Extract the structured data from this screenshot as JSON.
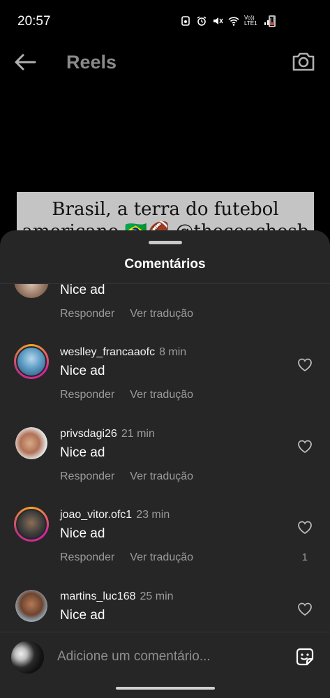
{
  "status_bar": {
    "time": "20:57",
    "network_label": "Vo)) LTE1",
    "icons": [
      "notification-icon",
      "alarm-icon",
      "mute-icon",
      "wifi-icon",
      "signal-icon",
      "battery-icon"
    ]
  },
  "header": {
    "title": "Reels",
    "back_icon": "arrow-left-icon",
    "camera_icon": "camera-icon"
  },
  "video": {
    "caption_line1": "Brasil, a terra do futebol",
    "caption_line2": "americano 🇧🇷🏈 @thecoachesb"
  },
  "comments_sheet": {
    "title": "Comentários",
    "comments": [
      {
        "username": "",
        "time": "",
        "text": "Nice ad",
        "reply_label": "Responder",
        "translate_label": "Ver tradução",
        "like_count": ""
      },
      {
        "username": "weslley_francaaofc",
        "time": "8 min",
        "text": "Nice ad",
        "reply_label": "Responder",
        "translate_label": "Ver tradução",
        "like_count": ""
      },
      {
        "username": "privsdagi26",
        "time": "21 min",
        "text": "Nice ad",
        "reply_label": "Responder",
        "translate_label": "Ver tradução",
        "like_count": ""
      },
      {
        "username": "joao_vitor.ofc1",
        "time": "23 min",
        "text": "Nice ad",
        "reply_label": "Responder",
        "translate_label": "Ver tradução",
        "like_count": "1"
      },
      {
        "username": "martins_luc168",
        "time": "25 min",
        "text": "Nice ad",
        "reply_label": "",
        "translate_label": "",
        "like_count": ""
      }
    ],
    "composer": {
      "placeholder": "Adicione um comentário...",
      "sticker_icon": "sticker-icon"
    }
  },
  "colors": {
    "background": "#000000",
    "sheet": "#262626",
    "secondary_text": "#9b9b9b",
    "story_ring": "#d6249f"
  }
}
